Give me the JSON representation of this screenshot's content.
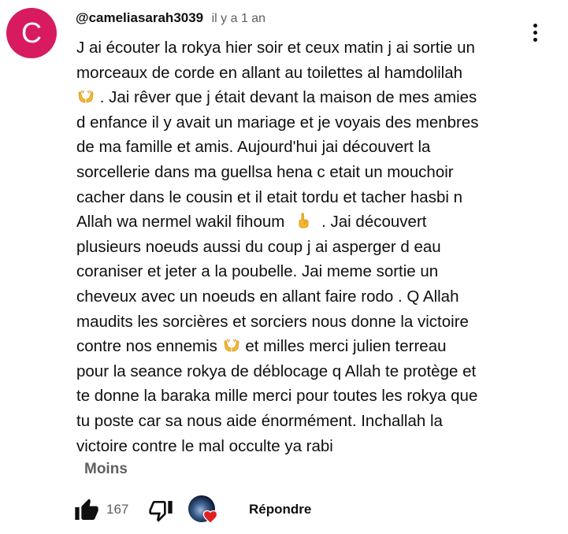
{
  "comment": {
    "avatar_letter": "C",
    "author": "@cameliasarah3039",
    "time": "il y a 1 an",
    "lines": [
      "J ai écouter la rokya hier soir et ceux matin j ai sortie un",
      "morceaux de corde en allant au toilettes al hamdolilah",
      ". Jai rêver que j était devant la maison de mes amies",
      "d enfance il y avait un mariage et je voyais des menbres",
      "de ma famille et amis. Aujourd'hui jai découvert la",
      "sorcellerie dans ma guellsa hena c etait un mouchoir",
      "cacher dans le cousin et il etait tordu et tacher hasbi n",
      "Allah wa nermel wakil fihoum",
      ". Jai découvert",
      "plusieurs noeuds aussi du coup j ai asperger d eau",
      "coraniser et jeter a la poubelle. Jai meme sortie un",
      "cheveux avec un noeuds en allant faire rodo . Q Allah",
      "maudits les sorcières et sorciers nous donne la victoire",
      "contre nos ennemis",
      "et milles merci julien terreau",
      "pour la seance rokya de déblocage q Allah te protège et",
      "te donne la baraka mille merci pour toutes les rokya que",
      "tu poste car sa nous aide énormément. Inchallah la",
      "victoire contre le mal occulte ya rabi"
    ],
    "show_less_label": "Moins",
    "like_count": "167",
    "reply_label": "Répondre"
  },
  "icons": {
    "menu": "more-vert-icon",
    "like": "thumbs-up-filled-icon",
    "dislike": "thumbs-down-outline-icon",
    "heart": "creator-heart-icon",
    "emoji_hands": "palms-up-together-emoji",
    "emoji_finger": "index-pointing-up-emoji"
  },
  "colors": {
    "avatar_bg": "#d81b60",
    "text": "#0f0f0f",
    "secondary_text": "#606060",
    "heart": "#e02020",
    "emoji": "#f5b82e"
  }
}
